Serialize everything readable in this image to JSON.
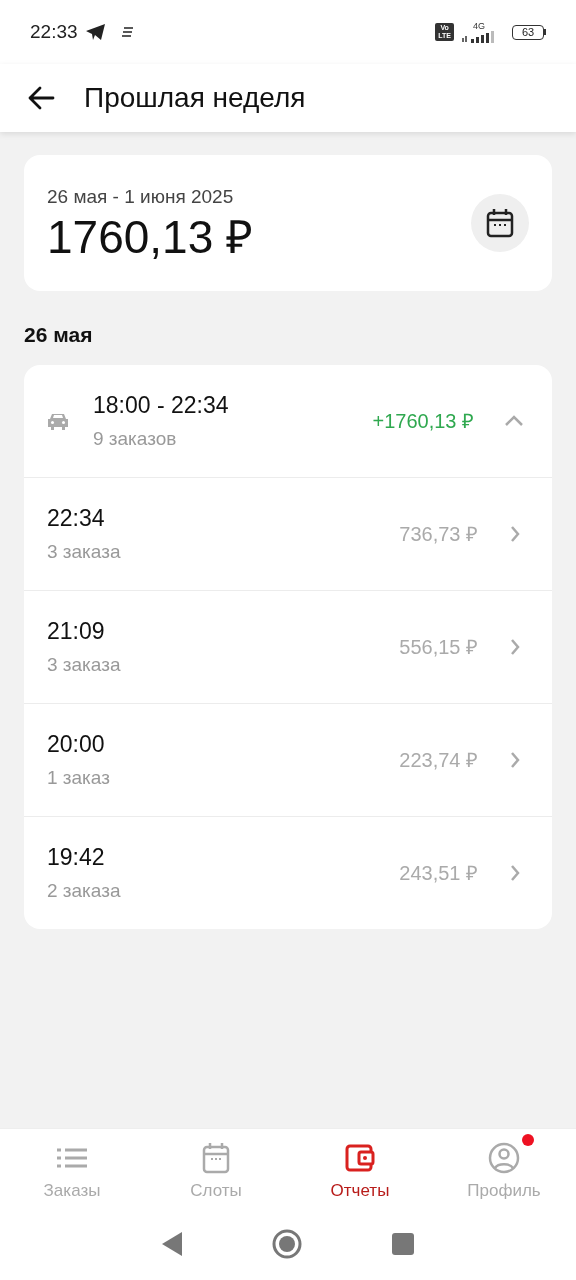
{
  "status_bar": {
    "time": "22:33",
    "volte": [
      "Vo",
      "LTE"
    ],
    "network": "4G",
    "battery": "63"
  },
  "header": {
    "title": "Прошлая неделя"
  },
  "summary": {
    "period": "26 мая - 1 июня 2025",
    "total": "1760,13 ₽"
  },
  "day": {
    "label": "26 мая"
  },
  "shift": {
    "time": "18:00 - 22:34",
    "orders": "9 заказов",
    "amount": "+1760,13 ₽",
    "expanded": true,
    "rows": [
      {
        "time": "22:34",
        "orders": "3 заказа",
        "amount": "736,73 ₽"
      },
      {
        "time": "21:09",
        "orders": "3 заказа",
        "amount": "556,15 ₽"
      },
      {
        "time": "20:00",
        "orders": "1 заказ",
        "amount": "223,74 ₽"
      },
      {
        "time": "19:42",
        "orders": "2 заказа",
        "amount": "243,51 ₽"
      }
    ]
  },
  "bottom_nav": [
    {
      "kind": "list",
      "label": "Заказы",
      "selected": false,
      "badge": false
    },
    {
      "kind": "calendar",
      "label": "Слоты",
      "selected": false,
      "badge": false
    },
    {
      "kind": "wallet",
      "label": "Отчеты",
      "selected": true,
      "badge": false
    },
    {
      "kind": "profile",
      "label": "Профиль",
      "selected": false,
      "badge": true
    }
  ]
}
